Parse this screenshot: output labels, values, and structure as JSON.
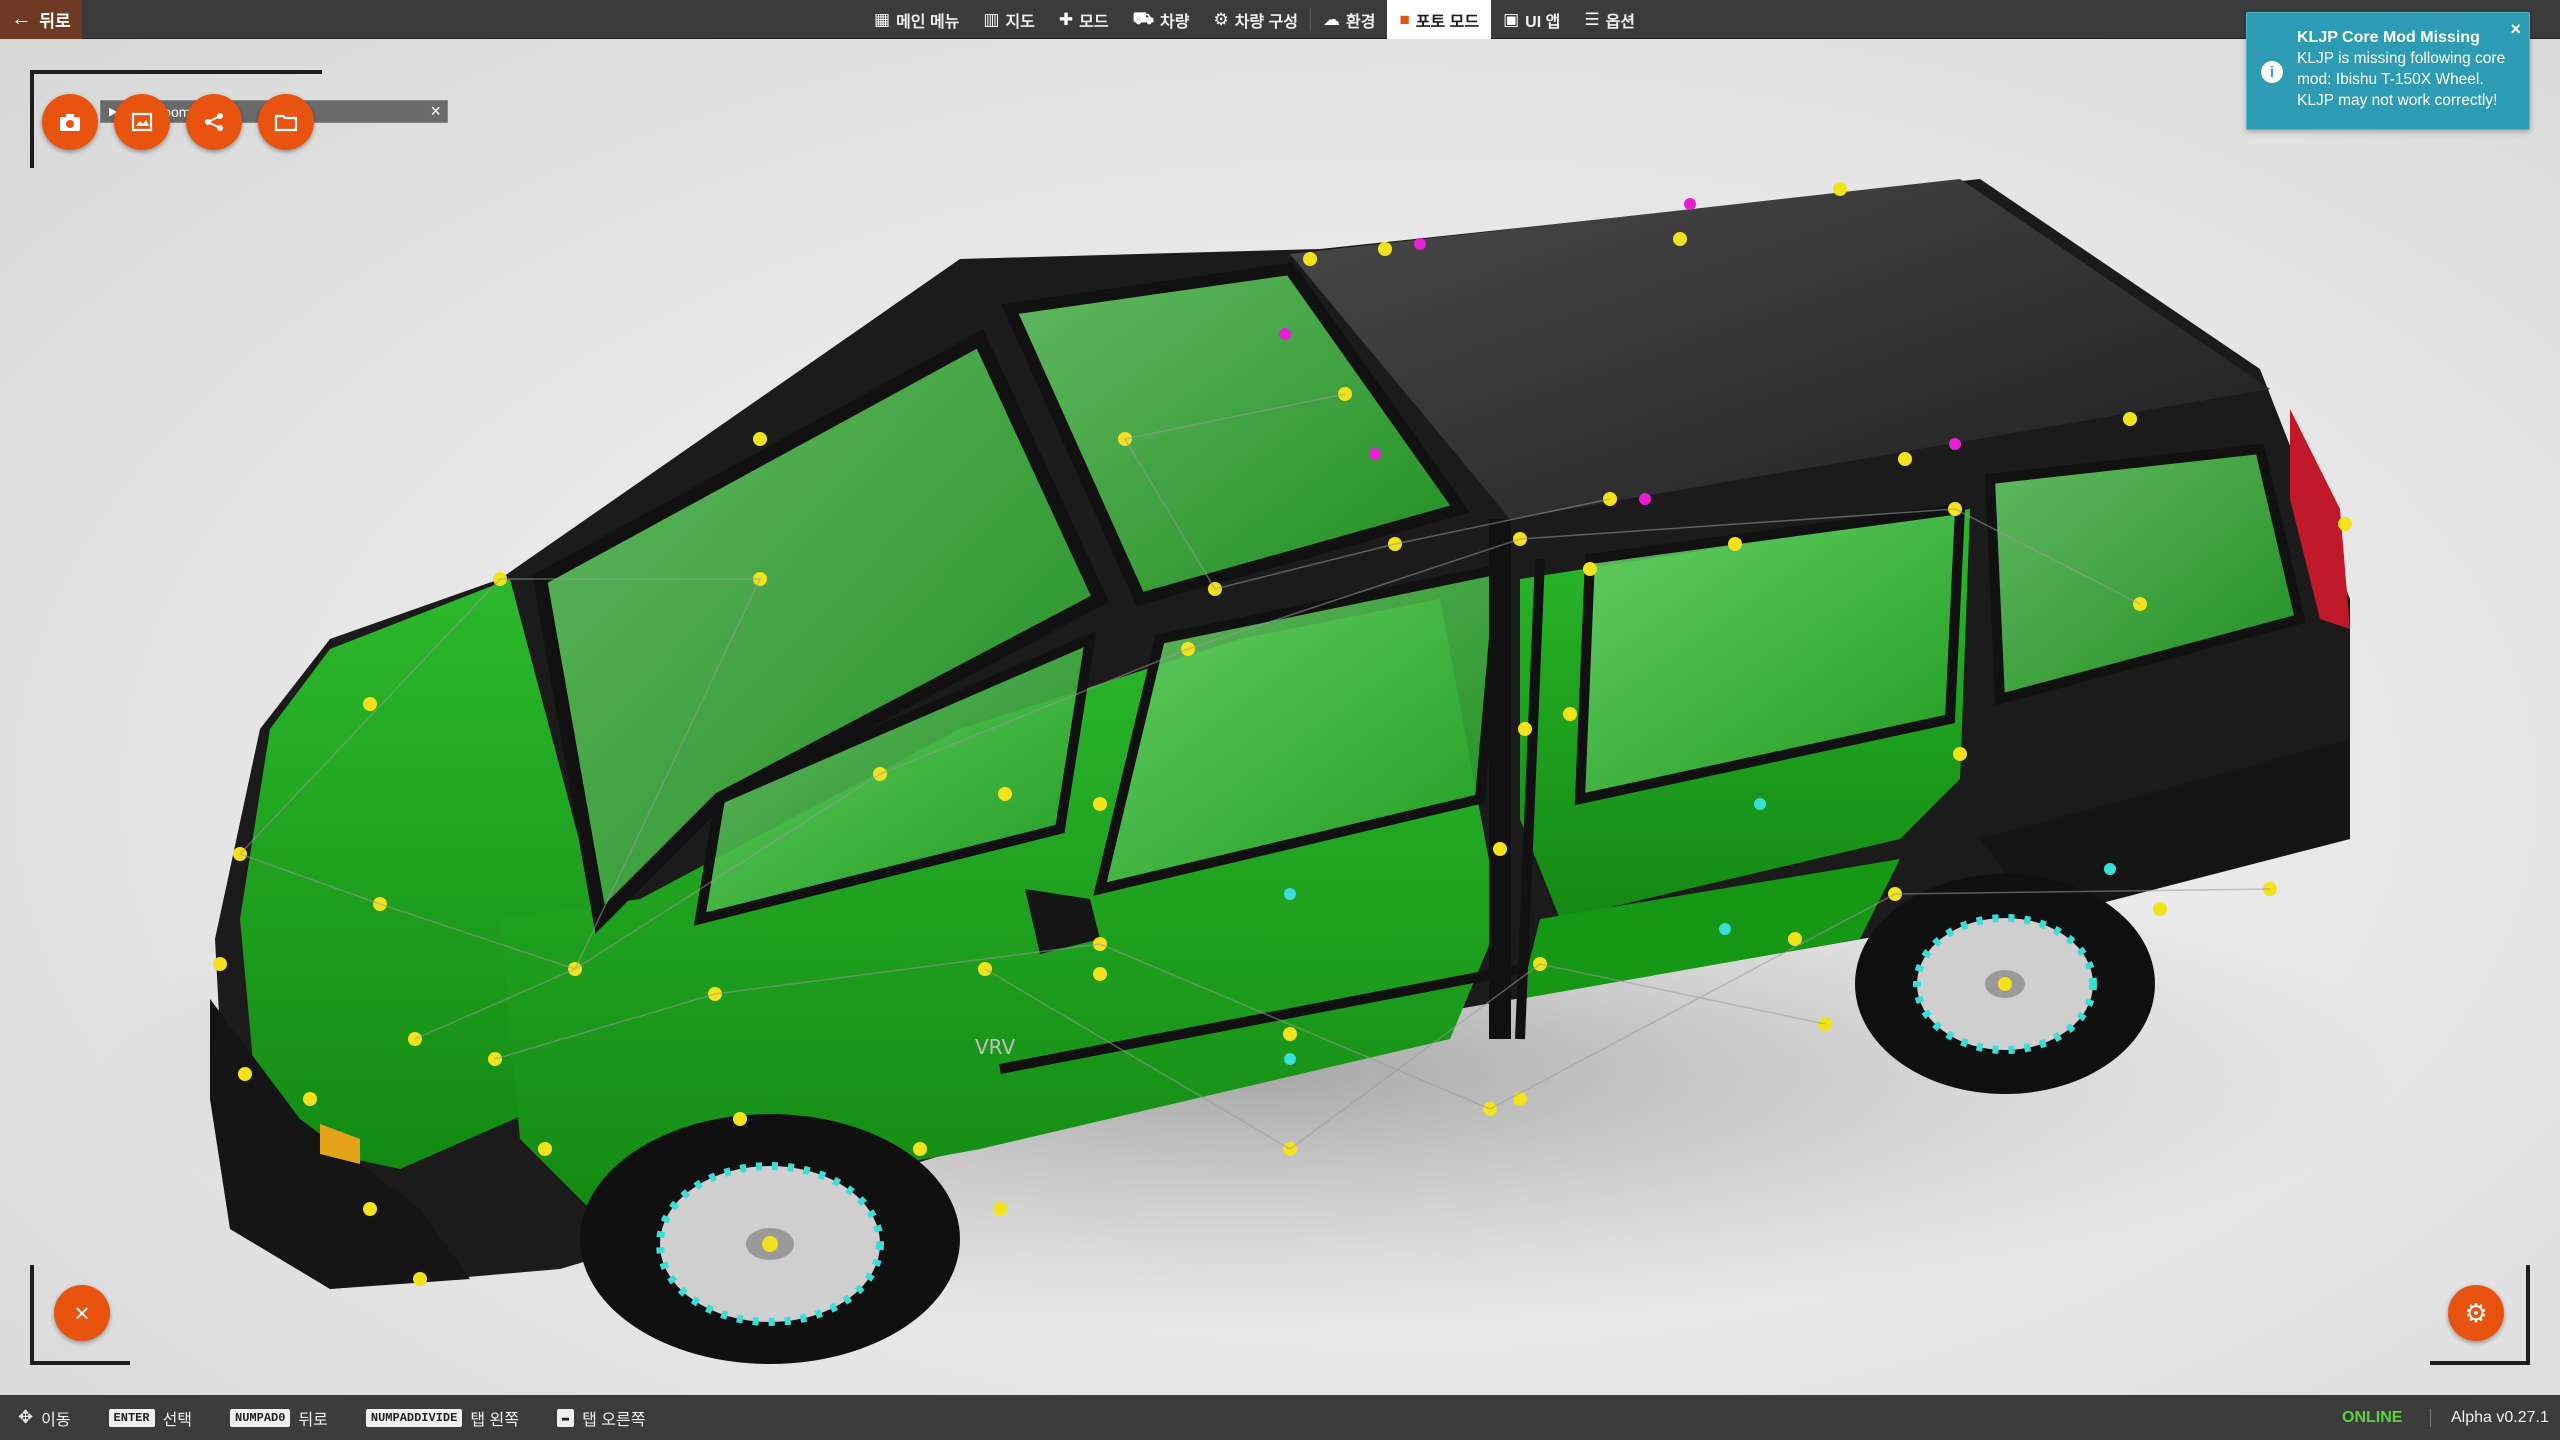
{
  "topbar": {
    "back_label": "뒤로",
    "menu": [
      {
        "label": "메인 메뉴",
        "icon": "grid-icon"
      },
      {
        "label": "지도",
        "icon": "map-icon"
      },
      {
        "label": "모드",
        "icon": "puzzle-icon"
      },
      {
        "label": "차량",
        "icon": "car-icon"
      },
      {
        "label": "차량 구성",
        "icon": "car-config-icon"
      },
      {
        "label": "환경",
        "icon": "weather-icon"
      },
      {
        "label": "포토 모드",
        "icon": "camera-icon",
        "active": true
      },
      {
        "label": "UI 앱",
        "icon": "ui-apps-icon"
      },
      {
        "label": "옵션",
        "icon": "sliders-icon"
      }
    ]
  },
  "notification": {
    "title": "KLJP Core Mod Missing",
    "message": "KLJP is missing following core mod: Ibishu T-150X Wheel. KLJP may not work correctly!",
    "close": "×",
    "color": "#2d9bb3"
  },
  "showroom": {
    "title": "Showroom Tools",
    "close": "×",
    "tools": [
      "camera-icon",
      "screenshot-icon",
      "share-icon",
      "folder-icon"
    ]
  },
  "car": {
    "badge": "VRV",
    "body_color": "#1fa31f",
    "trim_color": "#1c1c1c"
  },
  "bottombar": {
    "hints": [
      {
        "key": "",
        "label": "이동",
        "icon": "move-icon"
      },
      {
        "key": "ENTER",
        "label": "선택"
      },
      {
        "key": "NUMPAD0",
        "label": "뒤로"
      },
      {
        "key": "NUMPADDIVIDE",
        "label": "탭 왼쪽"
      },
      {
        "key": "",
        "label": "탭 오른쪽",
        "icon": "keyboard-icon"
      }
    ],
    "status": "ONLINE",
    "version": "Alpha v0.27.1"
  },
  "colors": {
    "accent": "#e8540f",
    "back_button": "#6f3a24",
    "online": "#5bd43a"
  }
}
